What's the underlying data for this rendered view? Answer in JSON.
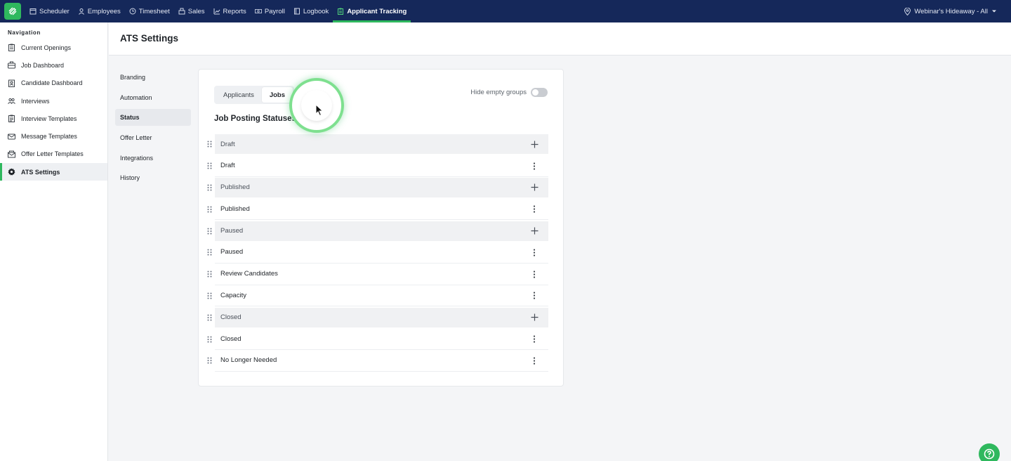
{
  "topbar": {
    "items": [
      {
        "label": "Scheduler",
        "icon": "calendar-icon"
      },
      {
        "label": "Employees",
        "icon": "person-icon"
      },
      {
        "label": "Timesheet",
        "icon": "clock-icon"
      },
      {
        "label": "Sales",
        "icon": "register-icon"
      },
      {
        "label": "Reports",
        "icon": "chart-icon"
      },
      {
        "label": "Payroll",
        "icon": "money-icon"
      },
      {
        "label": "Logbook",
        "icon": "book-icon"
      },
      {
        "label": "Applicant Tracking",
        "icon": "clipboard-icon",
        "active": true
      }
    ],
    "location": "Webinar's Hideaway - All"
  },
  "sidebar": {
    "heading": "Navigation",
    "items": [
      {
        "label": "Current Openings",
        "icon": "clipboard-icon"
      },
      {
        "label": "Job Dashboard",
        "icon": "briefcase-icon"
      },
      {
        "label": "Candidate Dashboard",
        "icon": "badge-icon"
      },
      {
        "label": "Interviews",
        "icon": "people-icon"
      },
      {
        "label": "Interview Templates",
        "icon": "clipboard-list-icon"
      },
      {
        "label": "Message Templates",
        "icon": "message-icon"
      },
      {
        "label": "Offer Letter Templates",
        "icon": "letter-icon"
      },
      {
        "label": "ATS Settings",
        "icon": "gear-icon",
        "active": true
      }
    ]
  },
  "page": {
    "title": "ATS Settings"
  },
  "subnav": {
    "items": [
      "Branding",
      "Automation",
      "Status",
      "Offer Letter",
      "Integrations",
      "History"
    ],
    "active": "Status"
  },
  "card": {
    "tabs": [
      "Applicants",
      "Jobs"
    ],
    "active_tab": "Jobs",
    "toggle_label": "Hide empty groups",
    "toggle_on": false,
    "section_title": "Job Posting Statuses",
    "rows": [
      {
        "type": "group",
        "label": "Draft"
      },
      {
        "type": "item",
        "label": "Draft"
      },
      {
        "type": "group",
        "label": "Published"
      },
      {
        "type": "item",
        "label": "Published"
      },
      {
        "type": "group",
        "label": "Paused"
      },
      {
        "type": "item",
        "label": "Paused"
      },
      {
        "type": "item",
        "label": "Review Candidates"
      },
      {
        "type": "item",
        "label": "Capacity"
      },
      {
        "type": "group",
        "label": "Closed"
      },
      {
        "type": "item",
        "label": "Closed"
      },
      {
        "type": "item",
        "label": "No Longer Needed"
      }
    ]
  },
  "colors": {
    "accent": "#2fb85e",
    "topbar": "#15285a"
  }
}
